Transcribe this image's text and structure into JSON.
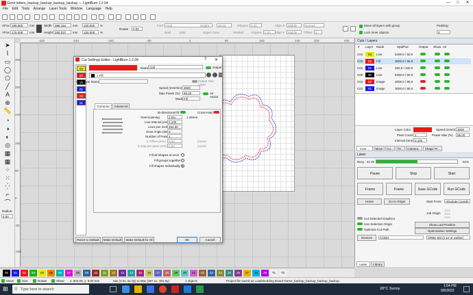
{
  "window": {
    "title": "Groot letters_backup_backup_backup_backup — LightBurn 1.2.04",
    "min": "—",
    "max": "□",
    "close": "✕"
  },
  "menu": [
    "File",
    "Edit",
    "Tools",
    "Arrange",
    "Laser Tools",
    "Window",
    "Language",
    "Help"
  ],
  "props": {
    "xpos_label": "XPos",
    "xpos": "199.000",
    "ypos_label": "YPos",
    "ypos": "176.000",
    "mm": "mm",
    "width_label": "Width",
    "width": "396.164",
    "height_label": "Height",
    "height": "250.037",
    "scale1": "100.000",
    "scale2": "100.000",
    "pct": "%",
    "rotate_label": "Rotate",
    "rotate": "0.00",
    "font_label": "Font",
    "font": "Arial",
    "height2_label": "Height",
    "height2": "25.00",
    "bold": "Bold",
    "italic": "Italic",
    "upper": "Upper Case",
    "welded": "Welded",
    "hspace_label": "HSpace",
    "hspace": "0.00",
    "vspace_label": "VSpace",
    "vspace": "0.00",
    "alignx_label": "Align X",
    "alignx": "Middle",
    "aligny_label": "Align Y",
    "aligny": "Middle",
    "normal": "Normal",
    "offset_label": "Offset",
    "offset": "0",
    "moveall": "Move all layers with group",
    "lockinner": "Lock inner objects",
    "padding_label": "Padding:",
    "padding": "0"
  },
  "ruler_top": [
    "-320",
    "-240",
    "-160",
    "-80",
    "0",
    "80",
    "160",
    "240",
    "320",
    "400"
  ],
  "ruler_left": [
    "400",
    "320",
    "240",
    "160",
    "80",
    "0",
    "-80",
    "-160"
  ],
  "tool_radius_label": "Radius:",
  "tool_radius": "0.00",
  "dialog": {
    "title": "Cut Settings Editor - LightBurn 1.2.04",
    "help": "?",
    "close": "✕",
    "layers": [
      {
        "n": "04",
        "c": "#e8e800",
        "fg": "#000"
      },
      {
        "n": "02",
        "c": "#e61a1a",
        "fg": "#fff"
      },
      {
        "n": "00",
        "c": "#000000",
        "fg": "#fff"
      },
      {
        "n": "01",
        "c": "#1a1ae6",
        "fg": "#fff"
      },
      {
        "n": "02",
        "c": "#e61a1a",
        "fg": "#fff"
      },
      {
        "n": "01",
        "c": "#1a1ae6",
        "fg": "#fff"
      }
    ],
    "name_label": "Name",
    "name_value": "C02",
    "output_label": "Output",
    "fill_label": "1 Fill",
    "output_sublayer": "Output Sub-Layer",
    "sublayer_name": "Sub-Layer Name",
    "speed_label": "Speed (mm/min)",
    "speed": "3000",
    "maxpower_label": "Max Power (%)",
    "maxpower": "95.00",
    "air_assist": "Air Assist",
    "mode_label": "Mode",
    "mode": "Fill",
    "tab_common": "Common",
    "tab_advanced": "Advanced",
    "bidir": "Bi-directional fill",
    "crosshatch": "Cross-Hatch",
    "overscan_label": "Overscanning",
    "overscan": "2.5%",
    "overscan_mm": "1.25mm",
    "interval_label": "Line Interval (mm)",
    "interval": "0.100",
    "lpi_label": "Lines per Inch",
    "lpi": "254.00",
    "angle_label": "Scan Angle (deg)",
    "angle": "0",
    "passes_label": "Number of Passes",
    "passes": "1",
    "zoffset_label": "Z Offset (mm)",
    "zoffset": "0.00",
    "zstep_label": "Z step per pass (mm)",
    "zstep": "0.00",
    "none1": "(none)",
    "none2": "(none)",
    "fill_all": "Fill all shapes at once",
    "fill_groups": "Fill groups together",
    "fill_indiv": "Fill shapes individually",
    "reset": "Reset to Default",
    "make_default": "Make Default",
    "make_default_all": "Make Default for All",
    "ok": "OK",
    "cancel": "Cancel"
  },
  "cuts": {
    "title": "Cuts / Layers",
    "headers": [
      "#",
      "Layer",
      "Mode",
      "Spd/Pwr",
      "Output",
      "Show",
      "Air"
    ],
    "rows": [
      {
        "n": "C04",
        "l": "04",
        "c": "#e8e800",
        "fg": "#000",
        "mode": "Line",
        "sp": "5400.0 / 50.0",
        "o": "on",
        "sel": false
      },
      {
        "n": "C02",
        "l": "02",
        "c": "#e61a1a",
        "fg": "#fff",
        "mode": "Fill",
        "sp": "3000.0 / 95.0",
        "o": "on",
        "sel": true
      },
      {
        "n": "C01",
        "l": "01",
        "c": "#1a1ae6",
        "fg": "#fff",
        "mode": "Line",
        "sp": "250.0 / 100.0",
        "o": "on",
        "sel": false
      },
      {
        "n": "C00",
        "l": "00",
        "c": "#000000",
        "fg": "#fff",
        "mode": "Line",
        "sp": "5400.0 / 50.0",
        "o": "on",
        "sel": false
      },
      {
        "n": "C02",
        "l": "02",
        "c": "#e61a1a",
        "fg": "#fff",
        "mode": "Image",
        "sp": "3000.0 / 95.0",
        "o": "off",
        "sel": false
      },
      {
        "n": "C01",
        "l": "01",
        "c": "#1a1ae6",
        "fg": "#fff",
        "mode": "Image",
        "sp": "3000.0 / 80.0",
        "o": "off",
        "sel": false
      }
    ],
    "layer_color": "Layer Color",
    "speed_label": "Speed (mm/m)",
    "speed": "3000",
    "passcount_label": "Pass Count",
    "passcount": "1",
    "power_label": "Power Max (%)",
    "power": "95.00",
    "interval_label": "Interval (mm)",
    "interval": "0.100",
    "tabs": [
      "Cuts ...",
      "Move",
      "Co...",
      "Fil...",
      "Camera...",
      "Shape Pr..."
    ]
  },
  "laser": {
    "title": "Laser",
    "busy": "Busy : 41:33",
    "percent": "51%",
    "progress": 0.51,
    "pause": "Pause",
    "stop": "Stop",
    "start": "Start",
    "frame1": "Frame",
    "frame2": "Frame",
    "save_gcode": "Save GCode",
    "run_gcode": "Run GCode",
    "home": "Home",
    "goto_origin": "Go to Origin",
    "start_from_label": "Start From:",
    "start_from": "Absolute Coords",
    "job_origin": "Job Origin",
    "cut_selected": "Cut Selected Graphics",
    "use_selection": "Use Selection Origin",
    "optimize_path": "Optimize Cut Path",
    "show_last": "Show Last Position",
    "opt_settings": "Optimization Settings",
    "devices": "Devices",
    "port": "COM4",
    "controller": "GRBL-M3 (1.1e or earlier)",
    "tabs": [
      "Laser",
      "Library"
    ]
  },
  "palette": [
    {
      "n": "00",
      "c": "#000000",
      "fg": "#fff"
    },
    {
      "n": "01",
      "c": "#1a1ae6",
      "fg": "#fff"
    },
    {
      "n": "02",
      "c": "#e61a1a",
      "fg": "#fff"
    },
    {
      "n": "03",
      "c": "#1ab31a",
      "fg": "#fff"
    },
    {
      "n": "04",
      "c": "#e8e800",
      "fg": "#000"
    },
    {
      "n": "05",
      "c": "#e68a00",
      "fg": "#000"
    },
    {
      "n": "06",
      "c": "#00b3b3",
      "fg": "#fff"
    },
    {
      "n": "07",
      "c": "#e600e6",
      "fg": "#fff"
    },
    {
      "n": "08",
      "c": "#b4b4b4",
      "fg": "#000"
    },
    {
      "n": "09",
      "c": "#2a64a0",
      "fg": "#fff"
    },
    {
      "n": "10",
      "c": "#9a2a2a",
      "fg": "#fff"
    },
    {
      "n": "11",
      "c": "#7aa32a",
      "fg": "#fff"
    },
    {
      "n": "12",
      "c": "#a07a2a",
      "fg": "#fff"
    },
    {
      "n": "13",
      "c": "#6a2aa0",
      "fg": "#fff"
    },
    {
      "n": "14",
      "c": "#2aa0a0",
      "fg": "#fff"
    },
    {
      "n": "15",
      "c": "#a02a7a",
      "fg": "#fff"
    },
    {
      "n": "16",
      "c": "#c8c864",
      "fg": "#000"
    },
    {
      "n": "17",
      "c": "#6464c8",
      "fg": "#fff"
    },
    {
      "n": "18",
      "c": "#c86464",
      "fg": "#fff"
    },
    {
      "n": "19",
      "c": "#64c864",
      "fg": "#000"
    },
    {
      "n": "20",
      "c": "#64c8c8",
      "fg": "#000"
    },
    {
      "n": "21",
      "c": "#c864c8",
      "fg": "#000"
    },
    {
      "n": "22",
      "c": "#966432",
      "fg": "#fff"
    },
    {
      "n": "23",
      "c": "#32649a",
      "fg": "#fff"
    },
    {
      "n": "24",
      "c": "#8a8a3a",
      "fg": "#fff"
    },
    {
      "n": "25",
      "c": "#3a8a8a",
      "fg": "#fff"
    },
    {
      "n": "26",
      "c": "#8a3a8a",
      "fg": "#fff"
    },
    {
      "n": "27",
      "c": "#e6b400",
      "fg": "#000"
    },
    {
      "n": "28",
      "c": "#00b4e6",
      "fg": "#000"
    },
    {
      "n": "29",
      "c": "#b400e6",
      "fg": "#fff"
    },
    {
      "n": "T1",
      "c": "#f0f0f0",
      "fg": "#000"
    },
    {
      "n": "T2",
      "c": "#f0f0f0",
      "fg": "#000"
    }
  ],
  "status": {
    "move": "Move",
    "size": "Size",
    "rotate": "Rotate",
    "shear": "Shear",
    "coords": "x: 604.00, y: 9.00 mm",
    "minmax": "Min (3.0x, 51.0y) to Max (397.1x, 301.0y)",
    "objects": "1 objects",
    "saved": "Project file saved as Loadshedding Board Game_backup_backup_backup_backup."
  },
  "taskbar": {
    "search": "Type here to search",
    "weather": "28°C  Sunny",
    "time": "1:54 PM",
    "date": "9/6/2023"
  }
}
